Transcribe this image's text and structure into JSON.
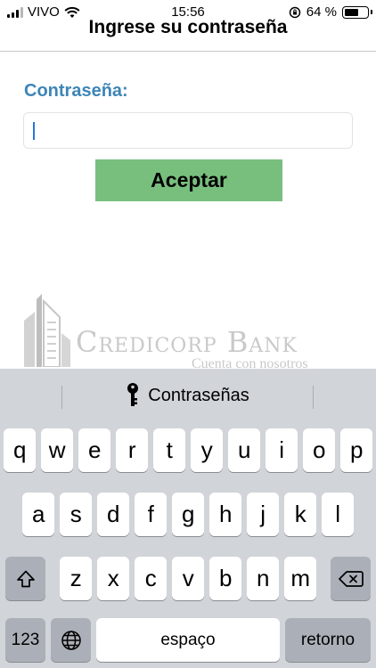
{
  "status_bar": {
    "carrier": "VIVO",
    "time": "15:56",
    "battery_percent_label": "64 %",
    "battery_level": 0.64
  },
  "header": {
    "title": "Ingrese su contraseña"
  },
  "form": {
    "password_label": "Contraseña:",
    "password_value": "",
    "accept_label": "Aceptar",
    "accent_color": "#3d85b8",
    "button_color": "#78bf7e"
  },
  "logo": {
    "name": "Credicorp Bank",
    "tagline": "Cuenta con nosotros"
  },
  "keyboard": {
    "suggestion_label": "Contraseñas",
    "row1": [
      "q",
      "w",
      "e",
      "r",
      "t",
      "y",
      "u",
      "i",
      "o",
      "p"
    ],
    "row2": [
      "a",
      "s",
      "d",
      "f",
      "g",
      "h",
      "j",
      "k",
      "l"
    ],
    "row3": [
      "z",
      "x",
      "c",
      "v",
      "b",
      "n",
      "m"
    ],
    "numbers_label": "123",
    "space_label": "espaço",
    "return_label": "retorno",
    "icons": {
      "shift": "shift-icon",
      "backspace": "backspace-icon",
      "globe": "globe-icon",
      "key": "key-icon"
    }
  }
}
